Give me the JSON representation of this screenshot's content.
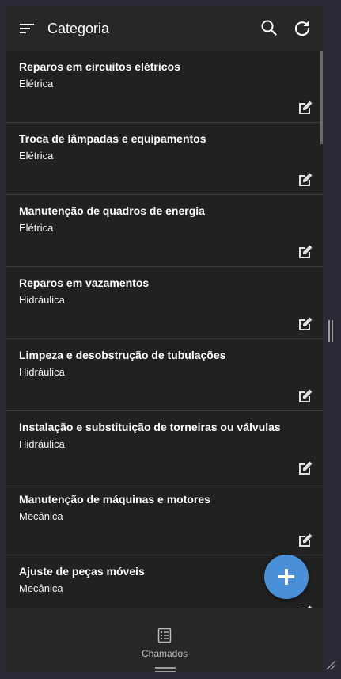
{
  "appbar": {
    "title": "Categoria",
    "menu_icon": "menu-icon",
    "search_icon": "search-icon",
    "refresh_icon": "refresh-icon"
  },
  "items": [
    {
      "name": "Reparos em circuitos elétricos",
      "category": "Elétrica"
    },
    {
      "name": "Troca de lâmpadas e equipamentos",
      "category": "Elétrica"
    },
    {
      "name": "Manutenção de quadros de energia",
      "category": "Elétrica"
    },
    {
      "name": "Reparos em vazamentos",
      "category": "Hidráulica"
    },
    {
      "name": "Limpeza e desobstrução de tubulações",
      "category": "Hidráulica"
    },
    {
      "name": "Instalação e substituição de torneiras ou válvulas",
      "category": "Hidráulica"
    },
    {
      "name": "Manutenção de máquinas e motores",
      "category": "Mecânica"
    },
    {
      "name": "Ajuste de peças móveis",
      "category": "Mecânica"
    }
  ],
  "bottom_nav": {
    "label": "Chamados",
    "icon": "list-alt-icon"
  },
  "fab": {
    "icon": "plus-icon"
  },
  "colors": {
    "background": "#212121",
    "appbar": "#272727",
    "accent": "#4a90d9",
    "divider": "#3c3c3c"
  }
}
